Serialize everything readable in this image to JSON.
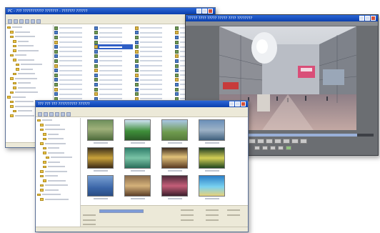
{
  "explorer": {
    "title": "PC - ??? ??????????? ??????? - ??????? ??????"
  },
  "browser": {
    "title": "??? ??? ??? ?????????? ??????"
  },
  "viewer": {
    "title": "????? ???? ????? ????? ???? ????????",
    "progress": 0.91
  },
  "colors": {
    "titlebar": "#1b58c8",
    "window_face": "#ece9d8",
    "viewer_panel": "#6b6e72",
    "selection": "#2f5fc6"
  },
  "icons": [
    "minimize-icon",
    "maximize-icon",
    "close-icon",
    "folder-icon",
    "image-file-icon",
    "play-icon",
    "pause-icon",
    "stop-icon"
  ]
}
